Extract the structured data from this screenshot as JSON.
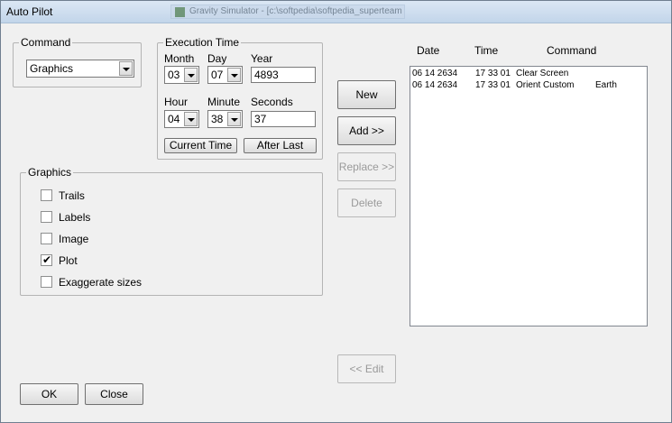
{
  "window": {
    "title": "Auto Pilot",
    "background_window_title": "Gravity Simulator - [c:\\softpedia\\softpedia_superteam"
  },
  "command": {
    "legend": "Command",
    "selected": "Graphics"
  },
  "execution_time": {
    "legend": "Execution Time",
    "month_label": "Month",
    "month_value": "03",
    "day_label": "Day",
    "day_value": "07",
    "year_label": "Year",
    "year_value": "4893",
    "hour_label": "Hour",
    "hour_value": "04",
    "minute_label": "Minute",
    "minute_value": "38",
    "seconds_label": "Seconds",
    "seconds_value": "37",
    "current_time_button": "Current Time",
    "after_last_button": "After Last"
  },
  "graphics": {
    "legend": "Graphics",
    "options": [
      {
        "label": "Trails",
        "checked": false
      },
      {
        "label": "Labels",
        "checked": false
      },
      {
        "label": "Image",
        "checked": false
      },
      {
        "label": "Plot",
        "checked": true
      },
      {
        "label": "Exaggerate sizes",
        "checked": false
      }
    ]
  },
  "actions": {
    "new": "New",
    "add": "Add >>",
    "replace": "Replace >>",
    "delete": "Delete",
    "edit": "<< Edit"
  },
  "list": {
    "headers": {
      "date": "Date",
      "time": "Time",
      "command": "Command"
    },
    "rows": [
      {
        "date": "06 14 2634",
        "time": "17 33 01",
        "command": "Clear Screen",
        "arg": ""
      },
      {
        "date": "06 14 2634",
        "time": "17 33 01",
        "command": "Orient Custom",
        "arg": "Earth"
      }
    ]
  },
  "footer": {
    "ok": "OK",
    "close": "Close"
  },
  "checkmark_glyph": "✔"
}
